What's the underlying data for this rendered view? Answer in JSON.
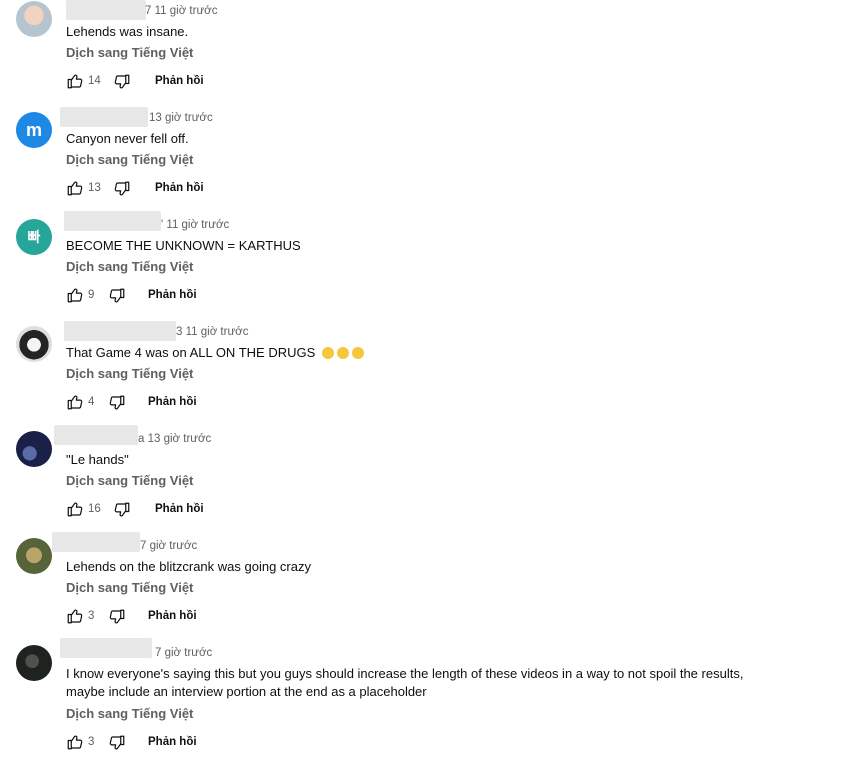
{
  "translate_label": "Dịch sang Tiếng Việt",
  "reply_label": "Phản hồi",
  "icons": {
    "like": "thumbs-up-icon",
    "dislike": "thumbs-down-icon",
    "laugh": "face-with-tears-of-joy-icon"
  },
  "comments": [
    {
      "avatar": "baby-photo",
      "author_suffix": "7",
      "time": "11 giờ trước",
      "text": "Lehends was insane.",
      "likes": "14"
    },
    {
      "avatar": "letter",
      "avatar_letter": "m",
      "avatar_color": "#1e88e5",
      "author_suffix": "",
      "time": "13 giờ trước",
      "text": "Canyon never fell off.",
      "likes": "13"
    },
    {
      "avatar": "letter",
      "avatar_letter": "빠",
      "avatar_color": "#26a69a",
      "author_suffix": "'",
      "time": "11 giờ trước",
      "text": "BECOME THE UNKNOWN = KARTHUS",
      "likes": "9"
    },
    {
      "avatar": "anime-character",
      "author_suffix": "3",
      "time": "11 giờ trước",
      "text": "That Game 4 was on ALL ON THE DRUGS",
      "text_emoji_count": 3,
      "likes": "4"
    },
    {
      "avatar": "night-scene",
      "author_suffix": "a",
      "time": "13 giờ trước",
      "text": "\"Le hands\"",
      "likes": "16"
    },
    {
      "avatar": "glowing-eyes-photo",
      "author_suffix": "",
      "time": "7 giờ trước",
      "text": "Lehends on the blitzcrank was going crazy",
      "likes": "3"
    },
    {
      "avatar": "dark-photo",
      "author_suffix": "",
      "time": "7 giờ trước",
      "text": "I know everyone's saying this but you guys should increase the length of these videos in a way to not spoil the results, maybe include an interview portion at the end as a placeholder",
      "likes": "3"
    }
  ]
}
